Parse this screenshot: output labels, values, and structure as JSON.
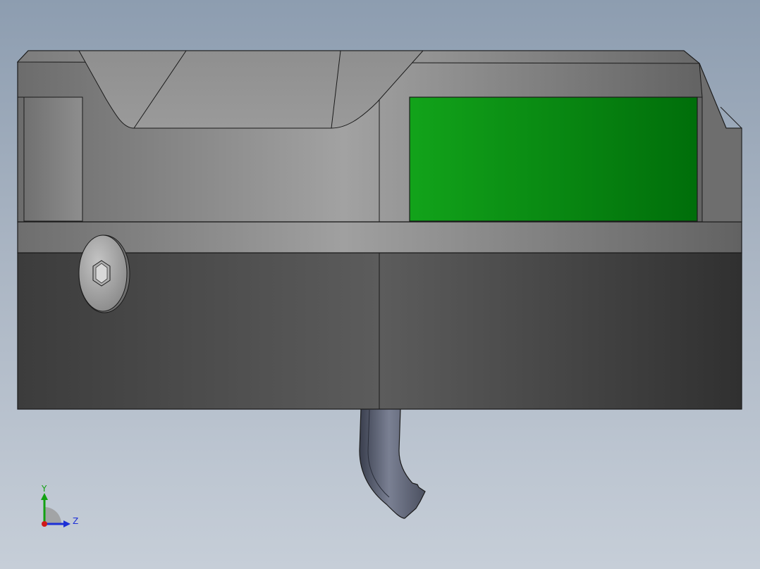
{
  "viewport": {
    "background_top": "#8d9db0",
    "background_bottom": "#c6ced8"
  },
  "part": {
    "body_light": "#a8a8a8",
    "body_dark": "#404040",
    "accent_green": "#0a8f12",
    "edge_color": "#1a1a1a"
  },
  "triad": {
    "y_label": "Y",
    "z_label": "Z",
    "y_color": "#12a112",
    "z_color": "#1c2fd6",
    "x_color": "#d01818"
  }
}
